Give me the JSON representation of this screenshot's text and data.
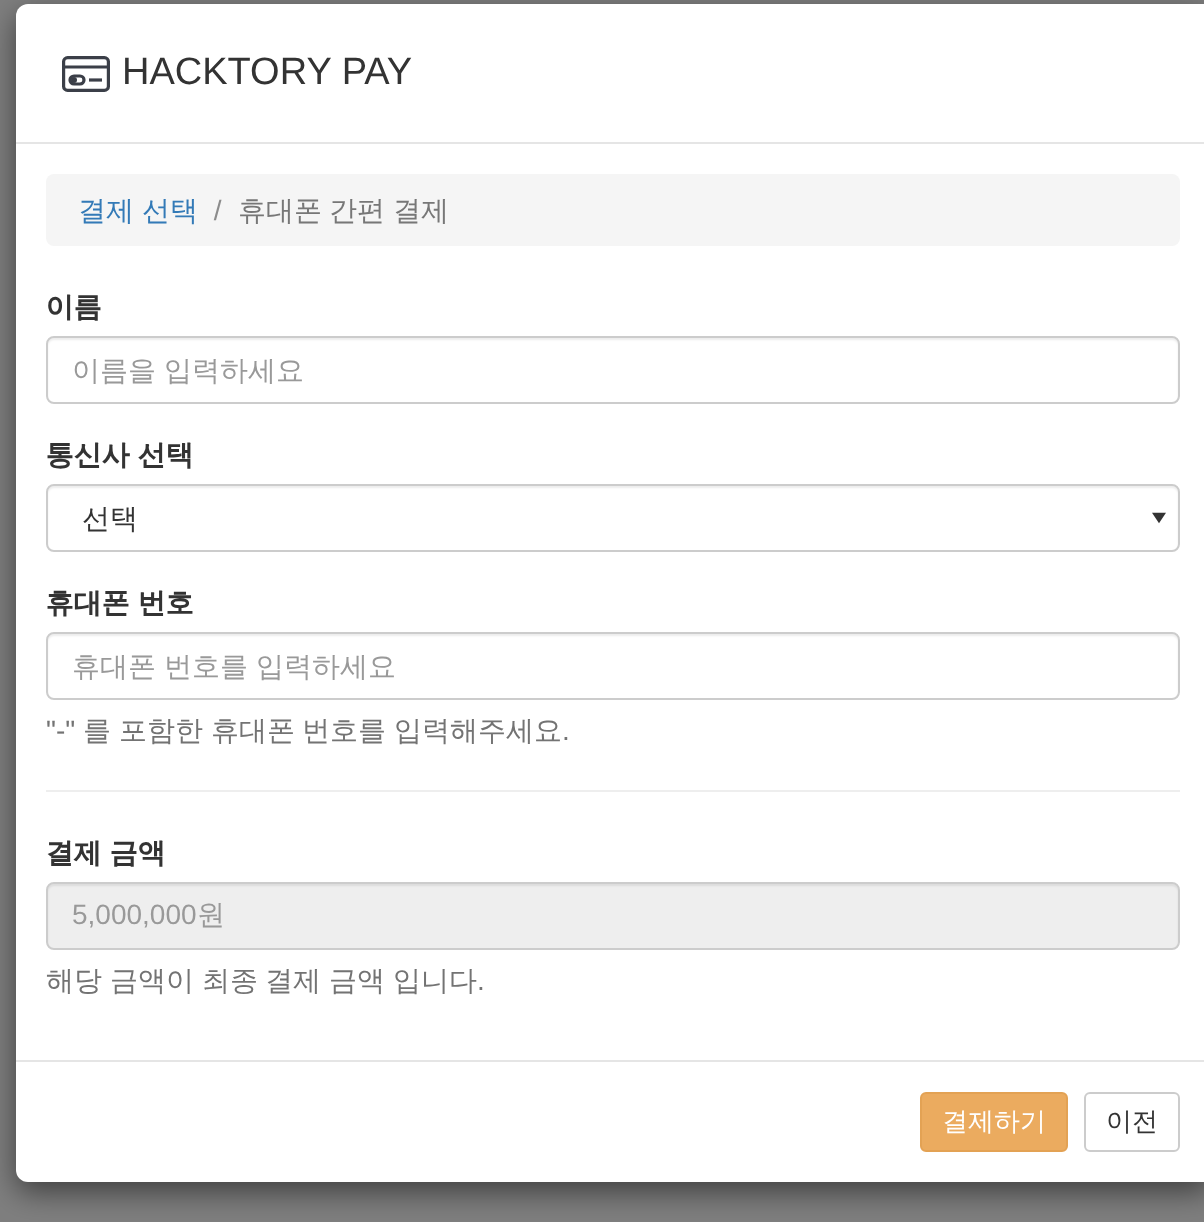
{
  "dialog": {
    "title": "HACKTORY PAY"
  },
  "breadcrumb": {
    "separator": "/",
    "items": [
      {
        "label": "결제 선택",
        "kind": "link"
      },
      {
        "label": "휴대폰 간편 결제",
        "kind": "current"
      }
    ]
  },
  "sections": [
    {
      "fields": [
        {
          "kind": "text",
          "label": "이름",
          "placeholder": "이름을 입력하세요",
          "disabled": false
        },
        {
          "kind": "select",
          "label": "통신사 선택",
          "value": "선택",
          "disabled": false
        },
        {
          "kind": "text",
          "label": "휴대폰 번호",
          "placeholder": "휴대폰 번호를 입력하세요",
          "disabled": false,
          "help": "\"-\" 를 포함한 휴대폰 번호를 입력해주세요."
        }
      ]
    },
    {
      "fields": [
        {
          "kind": "text",
          "label": "결제 금액",
          "value": "5,000,000원",
          "disabled": true,
          "help": "해당 금액이 최종 결제 금액 입니다."
        }
      ]
    }
  ],
  "buttons": [
    {
      "label": "결제하기",
      "kind": "primary"
    },
    {
      "label": "이전",
      "kind": "default"
    }
  ]
}
